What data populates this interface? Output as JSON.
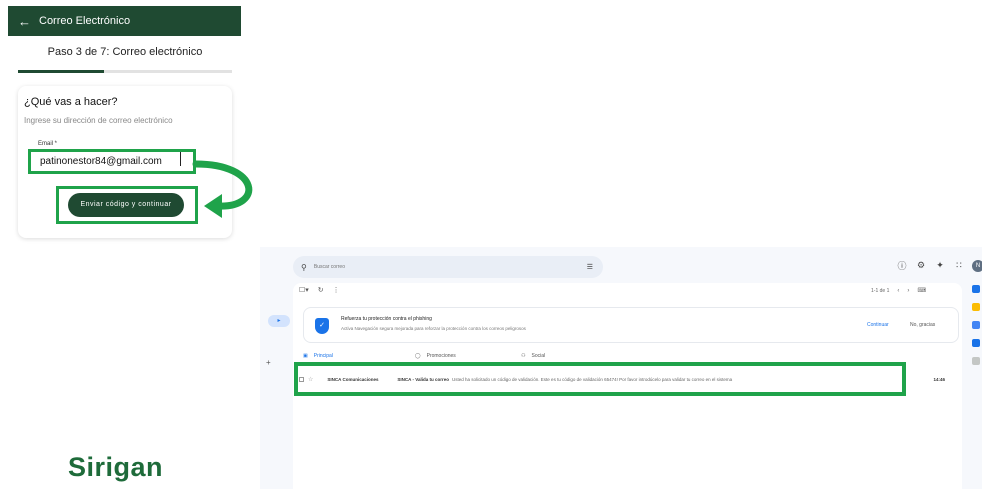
{
  "app": {
    "header_title": "Correo Electrónico",
    "back_icon": "arrow-left-icon",
    "step_label": "Paso 3 de 7: Correo electrónico",
    "progress": 0.4,
    "brand_color": "#1f4a32",
    "highlight_color": "#1fa34a"
  },
  "form": {
    "question": "¿Qué vas a hacer?",
    "hint": "Ingrese su dirección de correo electrónico",
    "email_label": "Email *",
    "email_value": "patinonestor84@gmail.com",
    "submit_label": "Enviar código y continuar"
  },
  "logo": {
    "text": "Sirigan"
  },
  "mail": {
    "search_placeholder": "Buscar correo",
    "top_icons": [
      "help-icon",
      "settings-icon",
      "sparkle-icon",
      "apps-icon"
    ],
    "avatar_initial": "N",
    "pager_text": "1-1 de 1",
    "banner": {
      "title": "Refuerza tu protección contra el phishing",
      "text": "Activa Navegación segura mejorada para reforzar la protección contra los correos peligrosos",
      "continue_label": "Continuar",
      "dismiss_label": "No, gracias"
    },
    "tabs": [
      {
        "label": "Principal",
        "icon": "inbox-icon"
      },
      {
        "label": "Promociones",
        "icon": "tag-icon"
      },
      {
        "label": "Social",
        "icon": "people-icon"
      }
    ],
    "message": {
      "sender": "SINCA Comunicaciones",
      "subject": "SINCA - Valida tu correo",
      "snippet": "Usted ha solicitado un código de validación. Este es tu código de validación 65474! Por favor introdúcelo para validar tu correo en el sistema",
      "time": "14:46"
    }
  }
}
